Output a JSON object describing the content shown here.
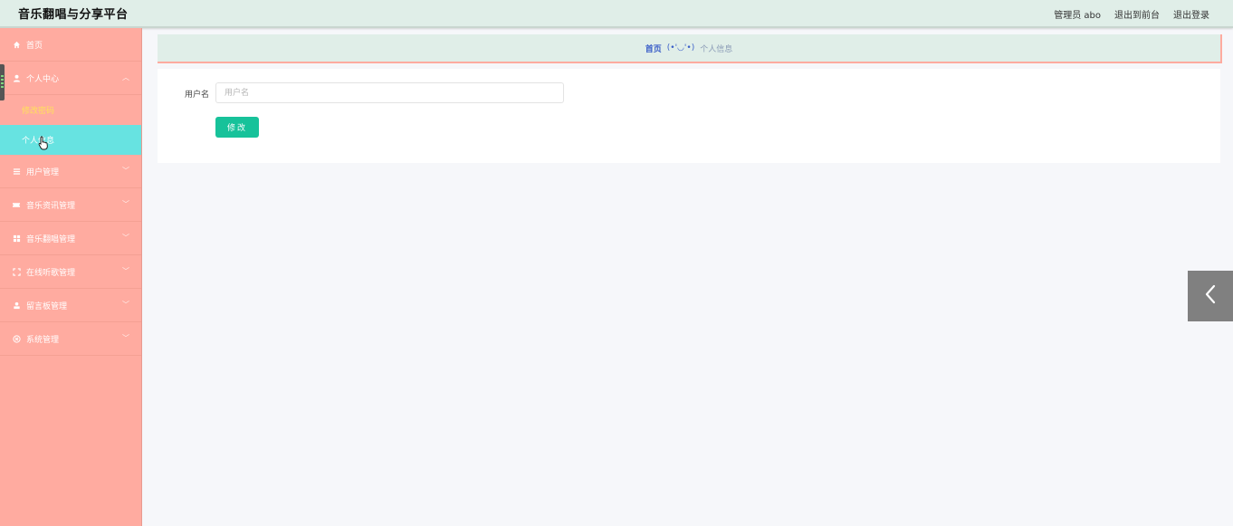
{
  "header": {
    "title": "音乐翻唱与分享平台",
    "admin_label": "管理员 abo",
    "to_front_label": "退出到前台",
    "logout_label": "退出登录"
  },
  "sidebar": {
    "items": [
      {
        "label": "首页",
        "icon": "home-icon"
      },
      {
        "label": "个人中心",
        "icon": "user-icon",
        "expanded": true,
        "children": [
          {
            "label": "修改密码"
          },
          {
            "label": "个人信息",
            "active": true
          }
        ]
      },
      {
        "label": "用户管理",
        "icon": "list-icon"
      },
      {
        "label": "音乐资讯管理",
        "icon": "ticket-icon"
      },
      {
        "label": "音乐翻唱管理",
        "icon": "grid-icon"
      },
      {
        "label": "在线听歌管理",
        "icon": "frame-icon"
      },
      {
        "label": "留言板管理",
        "icon": "person-icon"
      },
      {
        "label": "系统管理",
        "icon": "settings-icon"
      }
    ]
  },
  "breadcrumb": {
    "home": "首页",
    "separator": "(•'◡'•)",
    "current": "个人信息"
  },
  "form": {
    "username_label": "用户名",
    "username_placeholder": "用户名",
    "username_value": "",
    "submit_label": "修改"
  },
  "colors": {
    "sidebar_bg": "#ffaba0",
    "sidebar_active": "#67e3e1",
    "header_bg": "#e0eee8",
    "button": "#17c29a",
    "sub_link": "#ffe15a"
  }
}
